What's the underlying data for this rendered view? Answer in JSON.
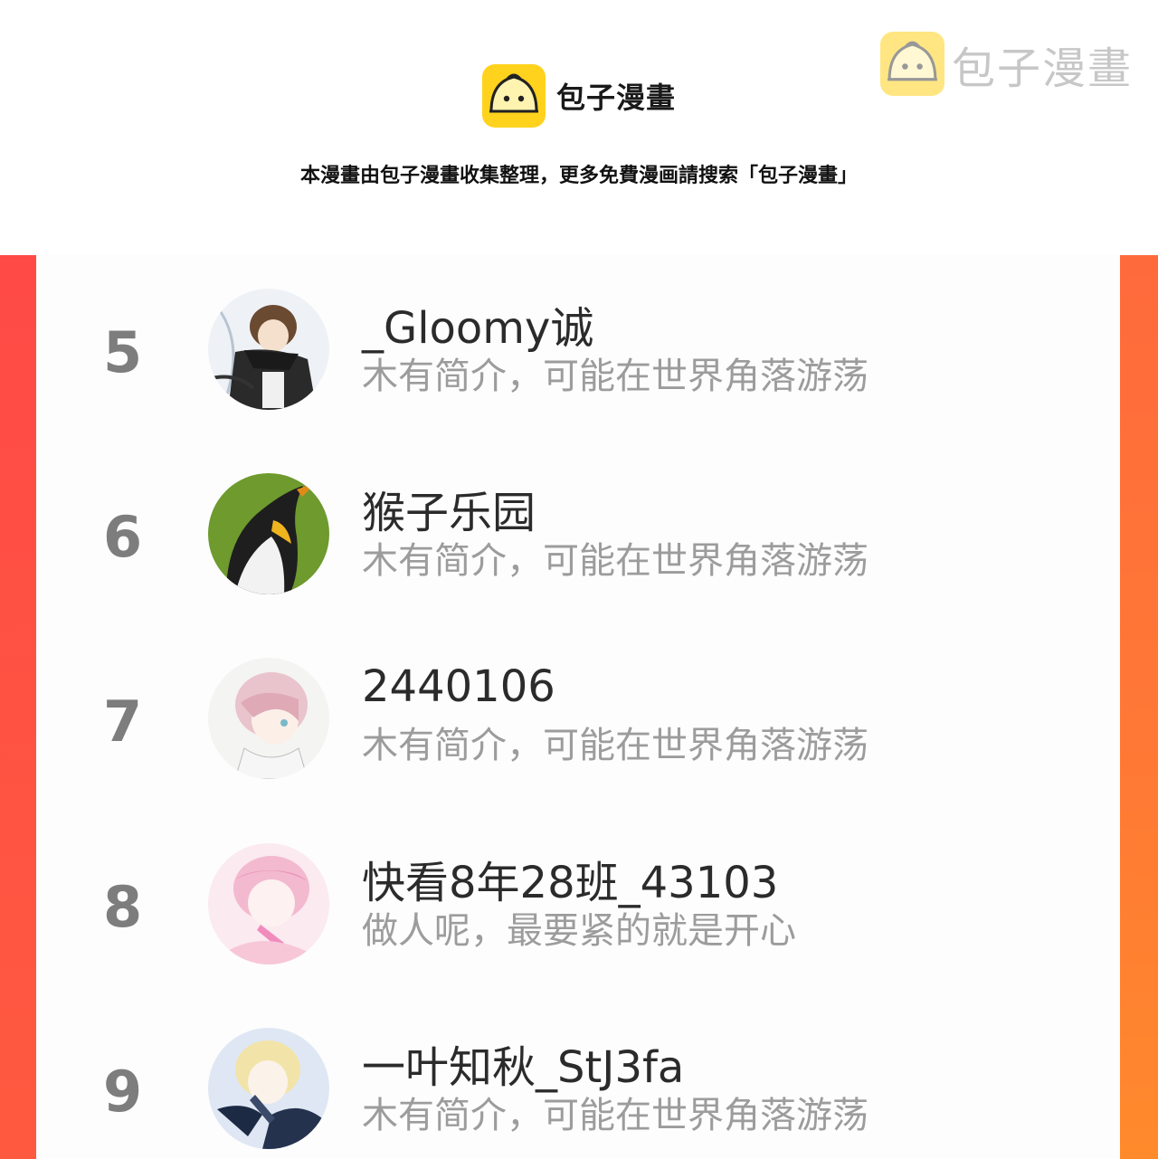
{
  "header": {
    "brand": "包子漫畫",
    "notice": "本漫畫由包子漫畫收集整理，更多免費漫画請搜索「包子漫畫」"
  },
  "watermark": {
    "text": "包子漫畫"
  },
  "colors": {
    "frame_left": "#ff4a46",
    "frame_right": "#ff7a34",
    "bun": "#ffd21e"
  },
  "ranking": [
    {
      "rank": "5",
      "name": "_Gloomy诚",
      "bio": "木有简介，可能在世界角落游荡",
      "avatar": "anime-boy-scarf-avatar"
    },
    {
      "rank": "6",
      "name": "猴子乐园",
      "bio": "木有简介，可能在世界角落游荡",
      "avatar": "penguin-avatar"
    },
    {
      "rank": "7",
      "name": "2440106",
      "bio": "木有简介，可能在世界角落游荡",
      "avatar": "anime-pink-hair-avatar"
    },
    {
      "rank": "8",
      "name": "快看8年28班_43103",
      "bio": "做人呢，最要紧的就是开心",
      "avatar": "anime-pink-singer-avatar"
    },
    {
      "rank": "9",
      "name": "一叶知秋_StJ3fa",
      "bio": "木有简介，可能在世界角落游荡",
      "avatar": "anime-blonde-singer-avatar"
    }
  ]
}
